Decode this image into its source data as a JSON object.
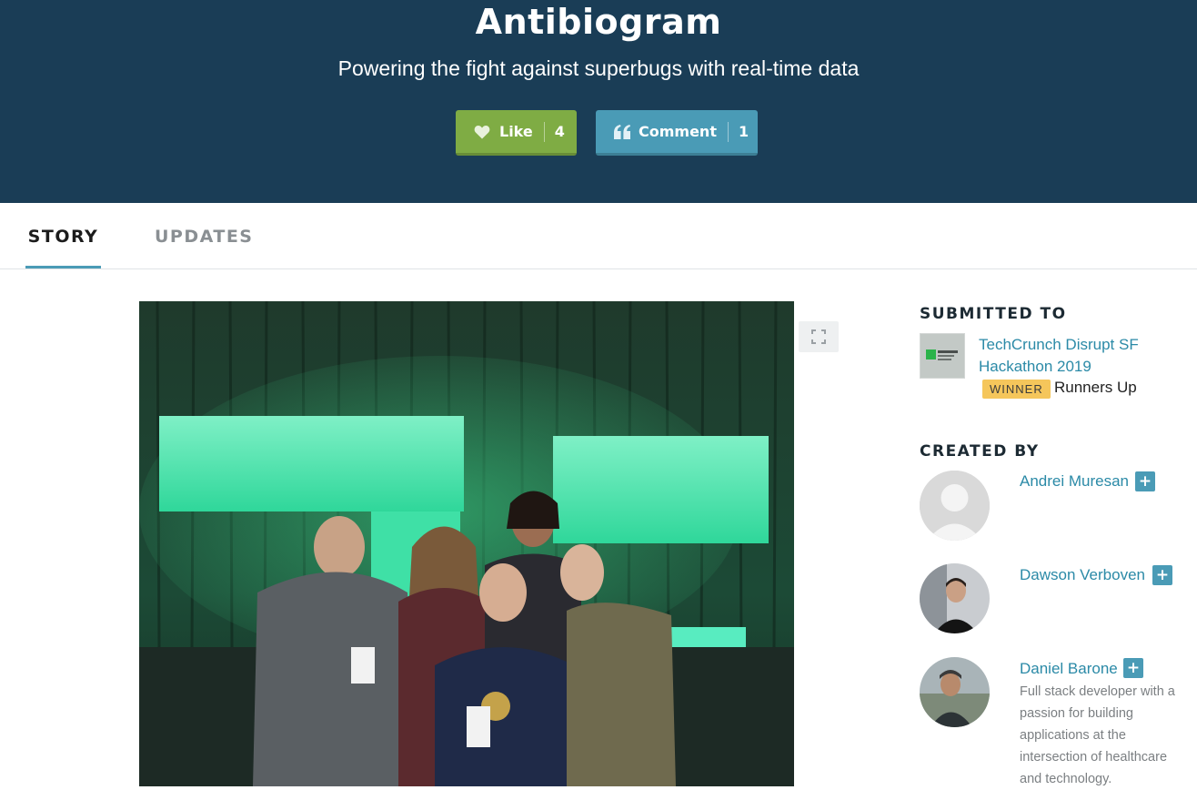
{
  "hero": {
    "title": "Antibiogram",
    "subtitle": "Powering the fight against superbugs with real-time data",
    "like_label": "Like",
    "like_count": "4",
    "comment_label": "Comment",
    "comment_count": "1"
  },
  "tabs": [
    {
      "label": "STORY",
      "active": true
    },
    {
      "label": "UPDATES",
      "active": false
    }
  ],
  "gallery": {
    "icons": {
      "expand": "expand-icon"
    }
  },
  "sidebar": {
    "submitted_heading": "SUBMITTED TO",
    "hackathon_name": "TechCrunch Disrupt SF Hackathon 2019",
    "winner_badge": "WINNER",
    "prize": "Runners Up",
    "created_heading": "CREATED BY",
    "members": [
      {
        "name": "Andrei Muresan",
        "follow": "+"
      },
      {
        "name": "Dawson Verboven",
        "follow": "+"
      },
      {
        "name": "Daniel Barone",
        "follow": "+",
        "bio": "Full stack developer with a passion for building applications at the intersection of healthcare and technology."
      }
    ]
  },
  "colors": {
    "hero_bg": "#1a3d56",
    "like_green": "#7fac44",
    "comment_blue": "#4a9bb6",
    "link": "#2b8aa7",
    "winner_yellow": "#f5c65b"
  }
}
